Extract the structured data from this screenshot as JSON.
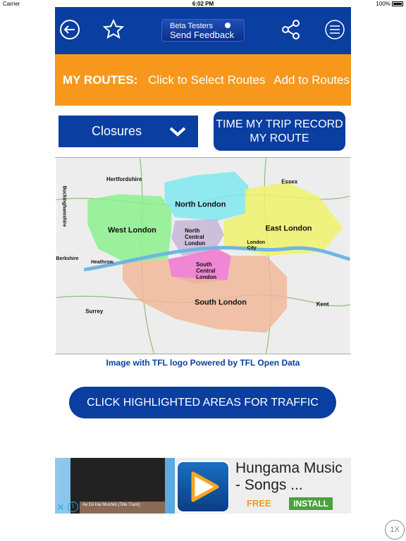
{
  "status_bar": {
    "carrier": "Carrier",
    "time": "6:02 PM",
    "battery": "100%"
  },
  "topbar": {
    "feedback_line1": "Beta Testers",
    "feedback_line2": "Send Feedback",
    "icons": [
      "back-arrow-icon",
      "star-icon",
      "share-icon",
      "menu-icon"
    ]
  },
  "routes_bar": {
    "label": "MY ROUTES:",
    "select": "Click to Select Routes",
    "add": "Add to Routes"
  },
  "filter_dropdown": {
    "selected": "Closures"
  },
  "time_trip_button": "TIME MY TRIP RECORD MY ROUTE",
  "map": {
    "labels": {
      "hertfordshire": "Hertfordshire",
      "essex": "Essex",
      "north": "North London",
      "west": "West London",
      "north_central_1": "North",
      "north_central_2": "Central",
      "north_central_3": "London",
      "east": "East London",
      "city_1": "London",
      "city_2": "City",
      "berkshire": "Berkshire",
      "heathrow": "Heathrow",
      "south_central_1": "South",
      "south_central_2": "Central",
      "south_central_3": "London",
      "surrey": "Surrey",
      "south": "South London",
      "kent": "Kent",
      "bucks": "Buckinghamshire"
    },
    "region_colors": {
      "north": "#7fe8ef",
      "west": "#8cf08c",
      "north_central": "#c9b8d8",
      "east": "#eef26a",
      "south_central": "#f07ad0",
      "south": "#f0b89a"
    }
  },
  "caption": "Image with TFL logo Powered by TFL Open Data",
  "traffic_button": "CLICK HIGHLIGHTED AREAS FOR TRAFFIC",
  "ad": {
    "title": "Hungama Music - Songs ...",
    "free": "FREE",
    "install": "INSTALL",
    "track": "Ae Dil Hai Mushkil (Title Track)"
  },
  "playback_rate": "1X",
  "colors": {
    "brand_blue": "#0a3ea0",
    "orange": "#f7981d"
  }
}
